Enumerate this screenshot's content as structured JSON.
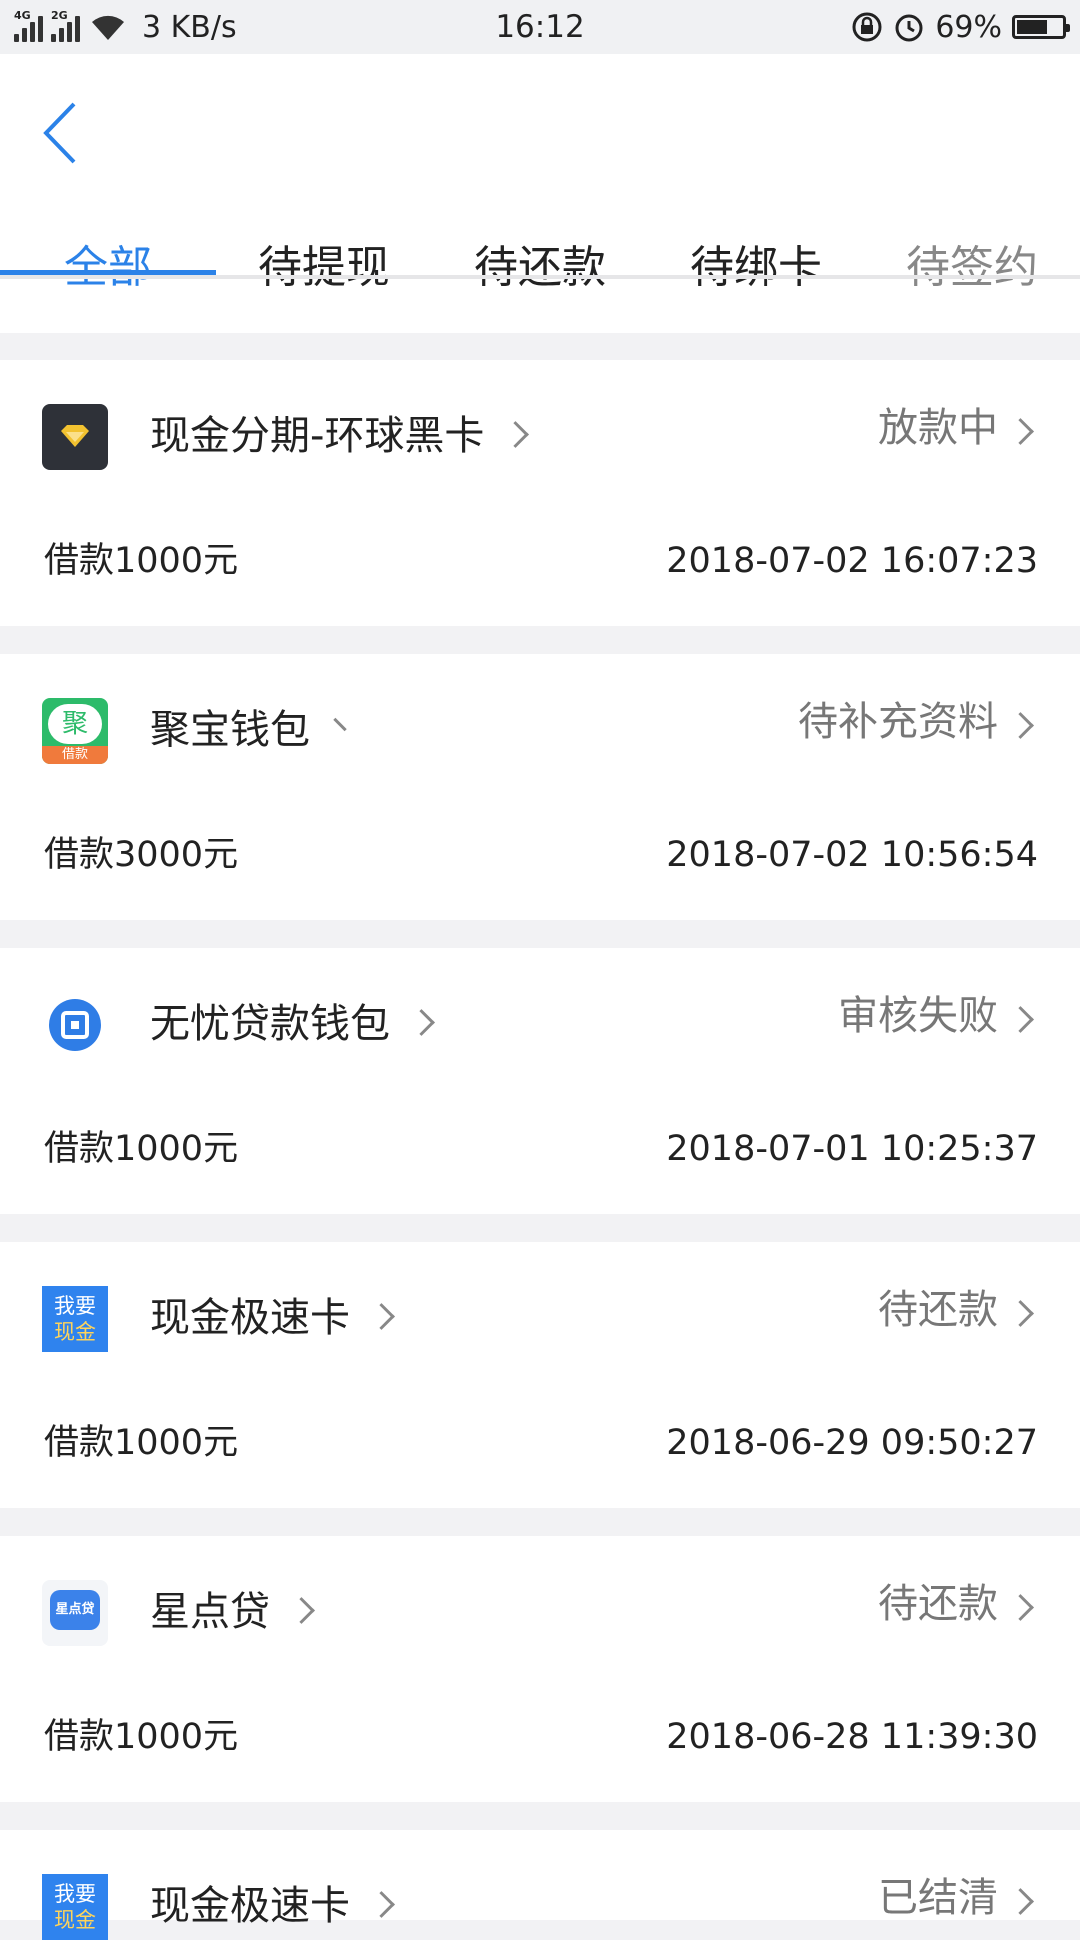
{
  "status_bar": {
    "net1": "4G",
    "net2": "2G",
    "speed": "3 KB/s",
    "time": "16:12",
    "battery_pct": "69%",
    "battery_level": 0.69
  },
  "tabs": [
    {
      "label": "全部",
      "active": true
    },
    {
      "label": "待提现",
      "active": false
    },
    {
      "label": "待还款",
      "active": false
    },
    {
      "label": "待绑卡",
      "active": false
    },
    {
      "label": "待签约",
      "active": false
    }
  ],
  "orders": [
    {
      "name": "现金分期-环球黑卡",
      "status": "放款中",
      "amount": "借款1000元",
      "date": "2018-07-02 16:07:23",
      "logo": "diamond-logo"
    },
    {
      "name": "聚宝钱包",
      "status": "待补充资料",
      "amount": "借款3000元",
      "date": "2018-07-02 10:56:54",
      "logo": "jubao-logo",
      "logo_text": "聚",
      "logo_sub": "借款"
    },
    {
      "name": "无忧贷款钱包",
      "status": "审核失败",
      "amount": "借款1000元",
      "date": "2018-07-01 10:25:37",
      "logo": "wuyou-logo"
    },
    {
      "name": "现金极速卡",
      "status": "待还款",
      "amount": "借款1000元",
      "date": "2018-06-29 09:50:27",
      "logo": "woyao-logo",
      "logo_text": "我要",
      "logo_sub": "现金"
    },
    {
      "name": "星点贷",
      "status": "待还款",
      "amount": "借款1000元",
      "date": "2018-06-28 11:39:30",
      "logo": "xingdian-logo",
      "logo_text": "星点贷"
    },
    {
      "name": "现金极速卡",
      "status": "已结清",
      "amount": "",
      "date": "",
      "logo": "woyao-logo",
      "logo_text": "我要",
      "logo_sub": "现金"
    }
  ],
  "colors": {
    "accent": "#2b82e8",
    "status_text": "#777777"
  }
}
